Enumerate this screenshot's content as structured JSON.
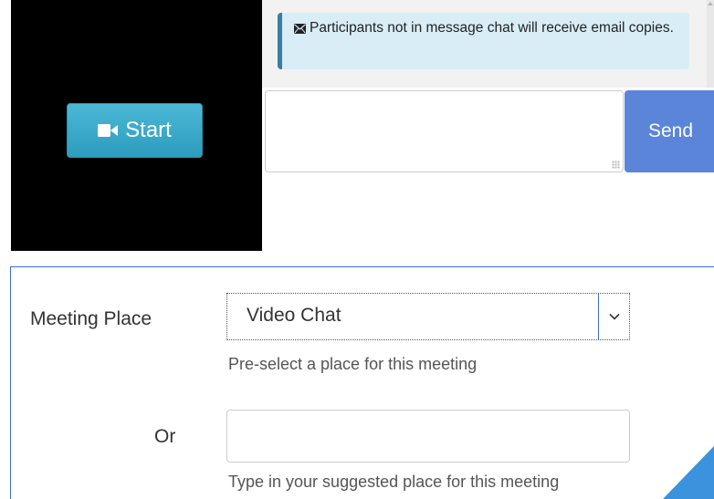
{
  "video": {
    "start_label": "Start",
    "start_icon": "video-camera-icon",
    "background": "#000000",
    "button_color": "#35a8c9"
  },
  "chat": {
    "notice_icon": "envelope-icon",
    "notice_text": "Participants not in message chat will receive email copies.",
    "message_value": "",
    "send_label": "Send",
    "send_color": "#5a85d8"
  },
  "meeting_form": {
    "place_label": "Meeting Place",
    "place_selected": "Video Chat",
    "place_help": "Pre-select a place for this meeting",
    "or_label": "Or",
    "suggest_value": "",
    "suggest_help": "Type in your suggested place for this meeting",
    "border_color": "#3b6ec7"
  }
}
